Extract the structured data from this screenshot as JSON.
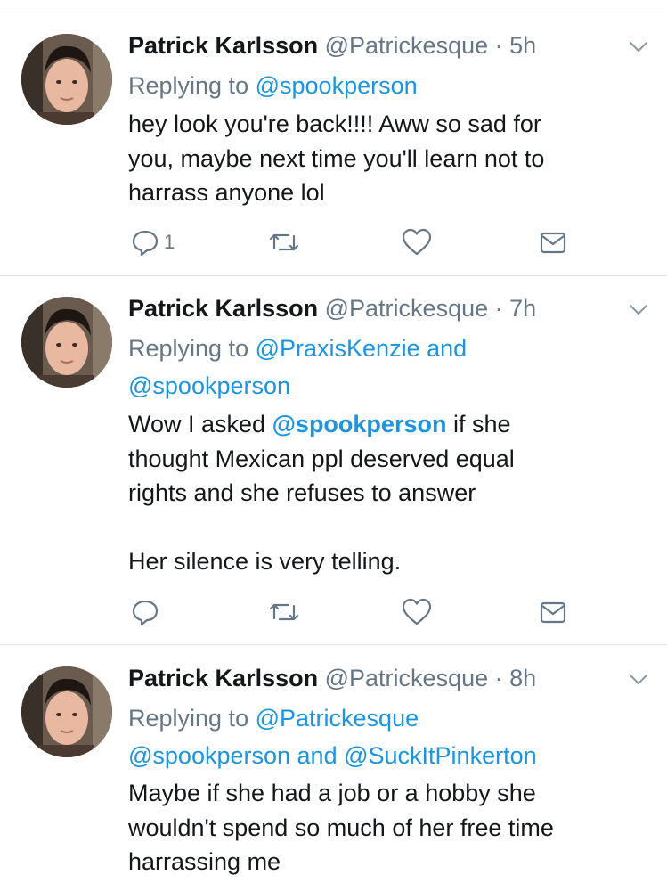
{
  "tweets": [
    {
      "name": "Patrick Karlsson",
      "handle": "@Patrickesque",
      "separator": "·",
      "time": "5h",
      "reply_prefix": "Replying to",
      "reply_lines": [
        [
          "@spookperson"
        ]
      ],
      "body_lines": [
        "hey look you're back!!!! Aww so sad for",
        "you, maybe next time you'll learn not to",
        "harrass anyone lol"
      ],
      "reply_count": "1"
    },
    {
      "name": "Patrick Karlsson",
      "handle": "@Patrickesque",
      "separator": "·",
      "time": "7h",
      "reply_prefix": "Replying to",
      "reply_line1_mention": "@PraxisKenzie",
      "reply_line1_and": "and",
      "reply_line2_mention": "@spookperson",
      "body_line1_prefix": "Wow I asked",
      "body_line1_mention": "@spookperson",
      "body_line1_suffix": "if she",
      "body_line2": "thought Mexican ppl deserved equal",
      "body_line3": "rights and she refuses to answer",
      "body_line5": "Her silence is very telling.",
      "reply_count": ""
    },
    {
      "name": "Patrick Karlsson",
      "handle": "@Patrickesque",
      "separator": "·",
      "time": "8h",
      "reply_prefix": "Replying to",
      "reply_line1_mention": "@Patrickesque",
      "reply_line2_mention_a": "@spookperson",
      "reply_line2_and": "and",
      "reply_line2_mention_b": "@SuckItPinkerton",
      "body_lines": [
        "Maybe if she had a job or a hobby she",
        "wouldn't spend so much of her free time",
        "harrassing me"
      ]
    }
  ],
  "icons": {
    "reply": "reply-icon",
    "retweet": "retweet-icon",
    "like": "heart-icon",
    "dm": "envelope-icon",
    "more": "chevron-down-icon"
  },
  "colors": {
    "link": "#1b95e0",
    "meta": "#657786",
    "text": "#14171a",
    "icon": "#657786"
  }
}
